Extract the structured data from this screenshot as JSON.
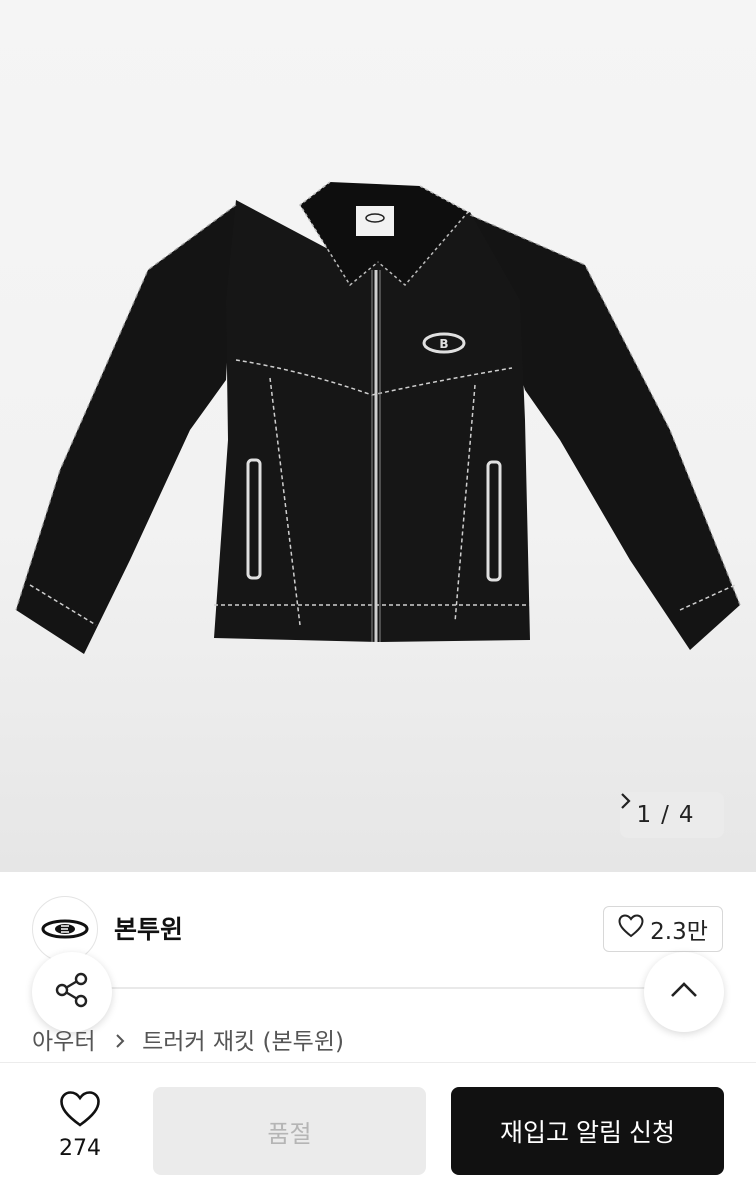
{
  "gallery": {
    "current": "1",
    "separator": "/",
    "total": "4"
  },
  "brand": {
    "name": "본투윈"
  },
  "likes": {
    "count": "2.3만"
  },
  "breadcrumb": {
    "category": "아우터",
    "product": "트러커 재킷 (본투윈)"
  },
  "bottom_bar": {
    "wish_count": "274",
    "soldout_label": "품절",
    "restock_label": "재입고 알림 신청"
  },
  "colors": {
    "primary_button": "#111111",
    "disabled_button": "#ebebeb"
  }
}
